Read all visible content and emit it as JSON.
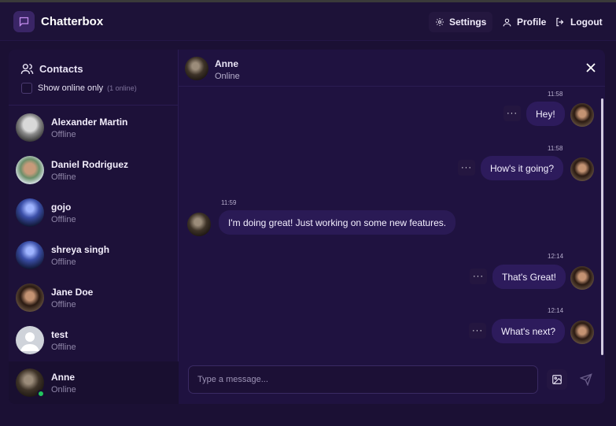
{
  "app": {
    "title": "Chatterbox"
  },
  "header": {
    "settings_label": "Settings",
    "profile_label": "Profile",
    "logout_label": "Logout"
  },
  "sidebar": {
    "title": "Contacts",
    "online_toggle_label": "Show online only",
    "online_count": "(1 online)",
    "contacts": [
      {
        "name": "Alexander Martin",
        "status": "Offline",
        "avatar": "person-bw-photo"
      },
      {
        "name": "Daniel Rodriguez",
        "status": "Offline",
        "avatar": "person-outdoor-photo"
      },
      {
        "name": "gojo",
        "status": "Offline",
        "avatar": "anime-character-photo"
      },
      {
        "name": "shreya singh",
        "status": "Offline",
        "avatar": "anime-character-photo"
      },
      {
        "name": "Jane Doe",
        "status": "Offline",
        "avatar": "person-dark-photo"
      },
      {
        "name": "test",
        "status": "Offline",
        "avatar": "default-user-icon"
      },
      {
        "name": "Anne",
        "status": "Online",
        "avatar": "person-dark-photo",
        "active": true
      }
    ]
  },
  "chat": {
    "contact_name": "Anne",
    "contact_status": "Online",
    "messages": [
      {
        "time": "11:58",
        "text": "Hey!",
        "direction": "outgoing"
      },
      {
        "time": "11:58",
        "text": "How's it going?",
        "direction": "outgoing"
      },
      {
        "time": "11:59",
        "text": "I'm doing great! Just working on some new features.",
        "direction": "incoming"
      },
      {
        "time": "12:14",
        "text": "That's Great!",
        "direction": "outgoing"
      },
      {
        "time": "12:14",
        "text": "What's next?",
        "direction": "outgoing"
      }
    ],
    "more_label": "···",
    "input_placeholder": "Type a message..."
  },
  "colors": {
    "accent": "#2d1b5c",
    "online": "#22c55e",
    "background": "#1b1034"
  }
}
